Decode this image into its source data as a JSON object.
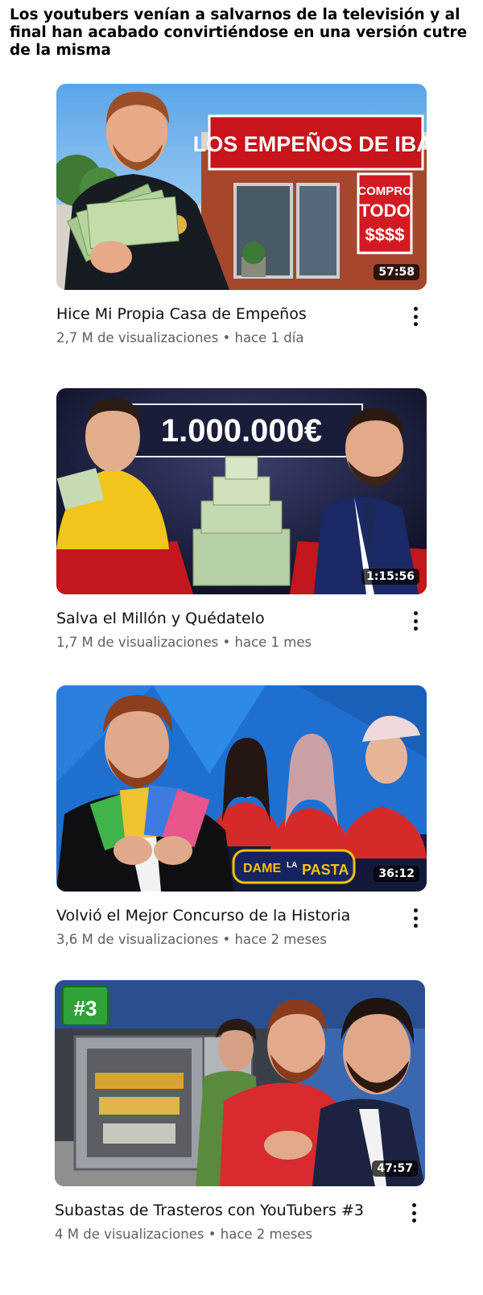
{
  "caption": "Los youtubers venían a salvarnos de la televisión y al final han acabado convirtiéndose en una versión cutre de la misma",
  "videos": [
    {
      "title": "Hice Mi Propia Casa de Empeños",
      "views": "2,7 M de visualizaciones",
      "age": "hace 1 día",
      "duration": "57:58",
      "thumb_sign": "LOS EMPEÑOS DE IBAI",
      "thumb_window": [
        "COMPRO",
        "TODO",
        "$$$$"
      ]
    },
    {
      "title": "Salva el Millón y Quédatelo",
      "views": "1,7 M de visualizaciones",
      "age": "hace 1 mes",
      "duration": "1:15:56",
      "thumb_amount": "1.000.000€"
    },
    {
      "title": "Volvió el Mejor Concurso de la Historia",
      "views": "3,6 M de visualizaciones",
      "age": "hace 2 meses",
      "duration": "36:12",
      "thumb_logo": [
        "DAME",
        "LA",
        "PASTA"
      ]
    },
    {
      "title": "Subastas de Trasteros con YouTubers #3",
      "views": "4 M de visualizaciones",
      "age": "hace 2 meses",
      "duration": "47:57",
      "thumb_badge": "#3"
    }
  ],
  "separator": "•"
}
